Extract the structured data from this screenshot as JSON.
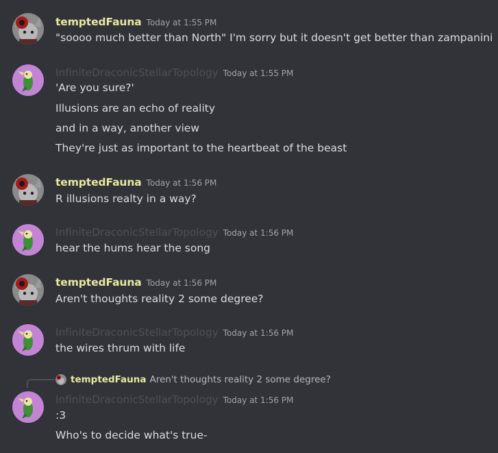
{
  "messages": [
    {
      "author": "temptedFauna",
      "timestamp": "Today at 1:55 PM",
      "lines": [
        "\"soooo much better than North\" I'm sorry but it doesn't get better than zampanini"
      ]
    },
    {
      "author": "InfiniteDraconicStellarTopology",
      "timestamp": "Today at 1:55 PM",
      "lines": [
        "'Are you sure?'",
        "Illusions are an echo of reality",
        "and in a way, another view",
        "They're just as important to the heartbeat of the beast"
      ]
    },
    {
      "author": "temptedFauna",
      "timestamp": "Today at 1:56 PM",
      "lines": [
        "R illusions realty in a way?"
      ]
    },
    {
      "author": "InfiniteDraconicStellarTopology",
      "timestamp": "Today at 1:56 PM",
      "lines": [
        "hear the hums hear the song"
      ]
    },
    {
      "author": "temptedFauna",
      "timestamp": "Today at 1:56 PM",
      "lines": [
        "Aren't thoughts reality 2 some degree?"
      ]
    },
    {
      "author": "InfiniteDraconicStellarTopology",
      "timestamp": "Today at 1:56 PM",
      "lines": [
        "the wires thrum with life"
      ]
    },
    {
      "author": "InfiniteDraconicStellarTopology",
      "timestamp": "Today at 1:56 PM",
      "reply": {
        "author": "temptedFauna",
        "text": "Aren't thoughts reality 2 some degree?"
      },
      "lines": [
        ":3",
        "Who's to decide what's true-"
      ]
    }
  ],
  "colors": {
    "background": "#313338",
    "fauna_name": "#e9e9a0",
    "infinite_name": "#4d5058",
    "text": "#dbdee1",
    "timestamp": "#a0a4ab"
  }
}
